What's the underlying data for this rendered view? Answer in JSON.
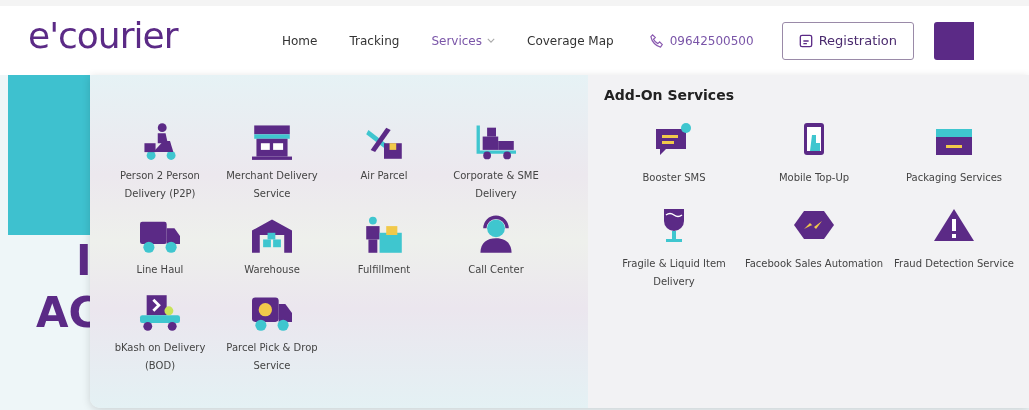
{
  "header": {
    "logo": "e'courier",
    "nav": [
      {
        "label": "Home",
        "selected": false,
        "dropdown": false
      },
      {
        "label": "Tracking",
        "selected": false,
        "dropdown": false
      },
      {
        "label": "Services",
        "selected": true,
        "dropdown": true
      },
      {
        "label": "Coverage Map",
        "selected": false,
        "dropdown": false
      }
    ],
    "phone": "09642500500",
    "registration": "Registration"
  },
  "hero": {
    "lines": [
      "I",
      "AC"
    ]
  },
  "services": [
    {
      "label": "Person 2 Person Delivery (P2P)"
    },
    {
      "label": "Merchant Delivery Service"
    },
    {
      "label": "Air Parcel"
    },
    {
      "label": "Corporate & SME Delivery"
    },
    {
      "label": "Line Haul"
    },
    {
      "label": "Warehouse"
    },
    {
      "label": "Fulfillment"
    },
    {
      "label": "Call Center"
    },
    {
      "label": "bKash on Delivery (BOD)"
    },
    {
      "label": "Parcel Pick & Drop Service"
    }
  ],
  "add_on": {
    "title": "Add-On Services",
    "items": [
      {
        "label": "Booster SMS"
      },
      {
        "label": "Mobile Top-Up"
      },
      {
        "label": "Packaging Services"
      },
      {
        "label": "Fragile & Liquid Item Delivery"
      },
      {
        "label": "Facebook Sales Automation"
      },
      {
        "label": "Fraud Detection Service"
      }
    ]
  }
}
